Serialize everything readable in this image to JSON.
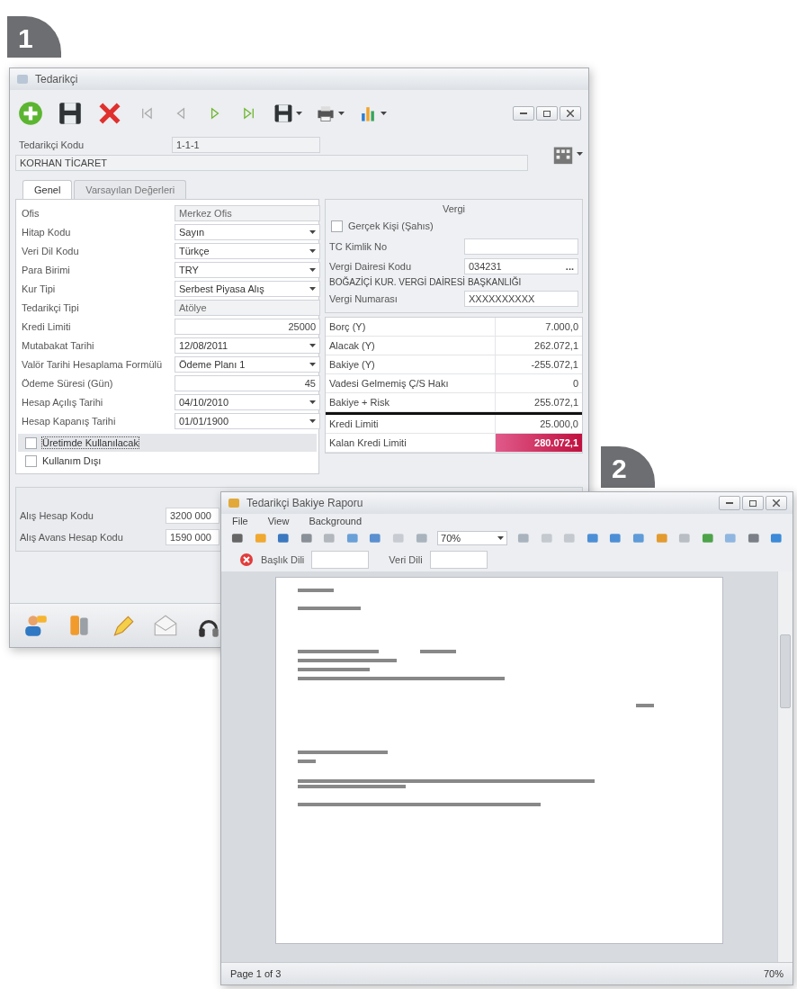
{
  "badges": [
    "1",
    "2"
  ],
  "supplier_window": {
    "title": "Tedarikçi",
    "code_label": "Tedarikçi Kodu",
    "code_value": "1-1-1",
    "name_value": "KORHAN TİCARET",
    "tabs": [
      {
        "label": "Genel",
        "selected": true
      },
      {
        "label": "Varsayılan Değerleri",
        "selected": false
      }
    ],
    "fields": [
      {
        "label": "Ofis",
        "value": "Merkez Ofis",
        "kind": "dropdown",
        "disabled": true
      },
      {
        "label": "Hitap Kodu",
        "value": "Sayın",
        "kind": "dropdown",
        "disabled": false
      },
      {
        "label": "Veri Dil Kodu",
        "value": "Türkçe",
        "kind": "dropdown",
        "disabled": false
      },
      {
        "label": "Para Birimi",
        "value": "TRY",
        "kind": "dropdown",
        "disabled": false
      },
      {
        "label": "Kur Tipi",
        "value": "Serbest Piyasa Alış",
        "kind": "dropdown",
        "disabled": false
      },
      {
        "label": "Tedarikçi Tipi",
        "value": "Atölye",
        "kind": "dropdown",
        "disabled": true
      },
      {
        "label": "Kredi Limiti",
        "value": "25000",
        "kind": "number",
        "disabled": false
      },
      {
        "label": "Mutabakat Tarihi",
        "value": "12/08/2011",
        "kind": "dropdown",
        "disabled": false
      },
      {
        "label": "Valör Tarihi Hesaplama Formülü",
        "value": "Ödeme Planı 1",
        "kind": "dropdown",
        "disabled": false
      },
      {
        "label": "Ödeme Süresi (Gün)",
        "value": "45",
        "kind": "number",
        "disabled": false
      },
      {
        "label": "Hesap Açılış Tarihi",
        "value": "04/10/2010",
        "kind": "dropdown",
        "disabled": false
      },
      {
        "label": "Hesap Kapanış Tarihi",
        "value": "01/01/1900",
        "kind": "dropdown",
        "disabled": false
      }
    ],
    "checkboxes": [
      {
        "label": "Üretimde Kullanılacak",
        "checked": false,
        "selected": true
      },
      {
        "label": "Kullanım Dışı",
        "checked": false,
        "selected": false
      }
    ],
    "tax": {
      "title": "Vergi",
      "items": [
        {
          "kind": "checkbox",
          "label": "Gerçek Kişi (Şahıs)",
          "checked": false
        },
        {
          "kind": "field",
          "label": "TC Kimlik No"
        },
        {
          "kind": "lookup",
          "label": "Vergi Dairesi Kodu",
          "value": "034231",
          "button": "..."
        },
        {
          "kind": "note",
          "label": "BOĞAZİÇİ KUR. VERGİ DAİRESİ BAŞKANLIĞI"
        },
        {
          "kind": "field",
          "label": "Vergi Numarası",
          "value": "XXXXXXXXXX"
        }
      ]
    },
    "balances": [
      {
        "label": "Borç (Y)",
        "value": "7.000,0",
        "alert": false
      },
      {
        "label": "Alacak (Y)",
        "value": "262.072,1",
        "alert": false
      },
      {
        "label": "Bakiye (Y)",
        "value": "-255.072,1",
        "alert": false
      },
      {
        "label": "Vadesi Gelmemiş Ç/S Hakı",
        "value": "0",
        "alert": false
      },
      {
        "label": "Bakiye + Risk",
        "value": "255.072,1",
        "alert": false
      }
    ],
    "credit": [
      {
        "label": "Kredi Limiti",
        "value": "25.000,0",
        "alert": false
      },
      {
        "label": "Kalan Kredi Limiti",
        "value": "280.072,1",
        "alert": true
      }
    ],
    "accounts": [
      {
        "label": "Alış Hesap Kodu",
        "value": "3200 000"
      },
      {
        "label": "Alış Avans Hesap Kodu",
        "value": "1590 000"
      }
    ]
  },
  "report_window": {
    "title": "Tedarikçi Bakiye Raporu",
    "menu": [
      "File",
      "View",
      "Background"
    ],
    "zoom": "70%",
    "params": [
      {
        "label": "Başlık Dili"
      },
      {
        "label": "Veri Dili"
      }
    ],
    "status": "Page 1 of 3",
    "status_zoom": "70%"
  }
}
